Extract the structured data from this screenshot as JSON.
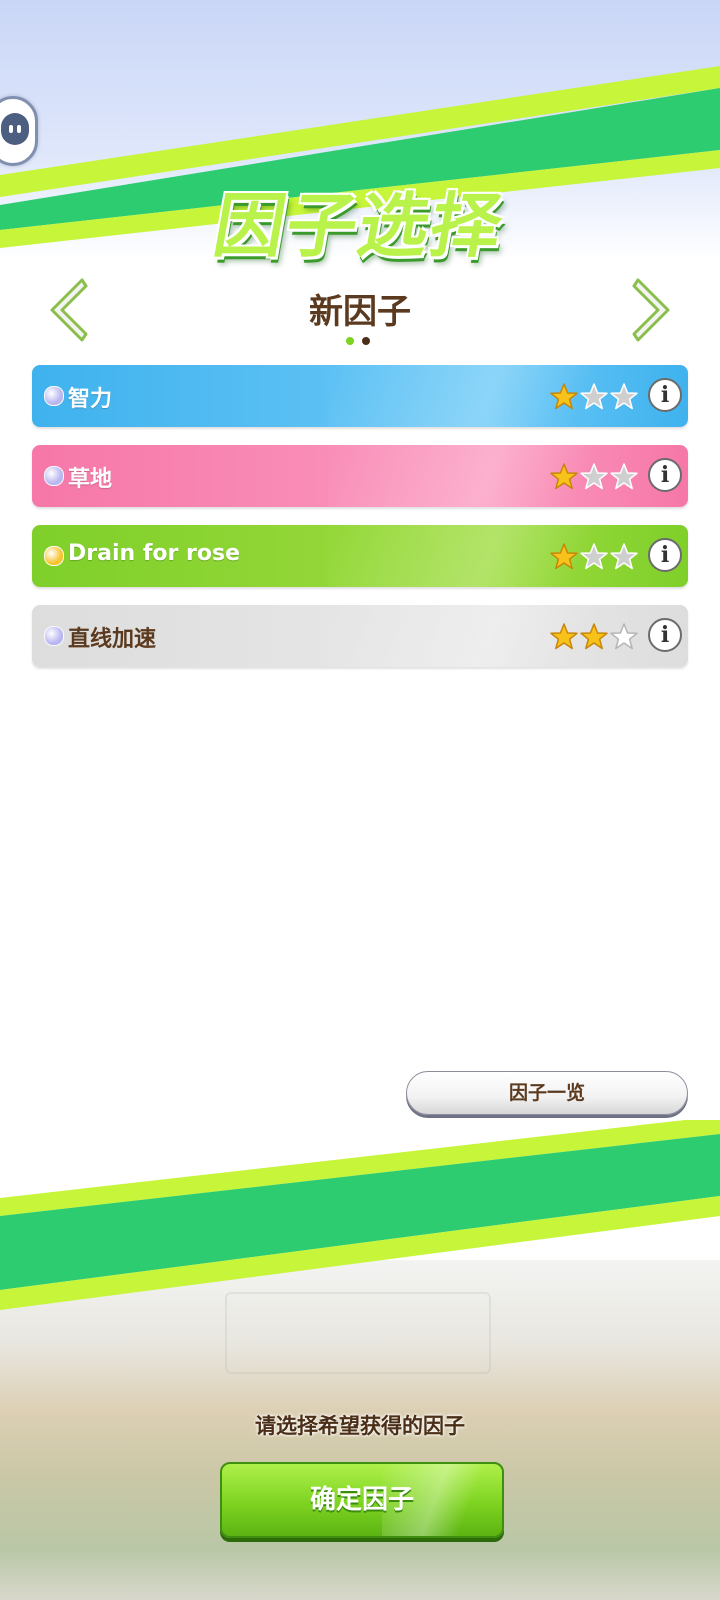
{
  "header": {
    "title": "因子选择"
  },
  "selector": {
    "subtitle": "新因子",
    "page_count": 2,
    "current_page": 1
  },
  "factors": [
    {
      "name": "智力",
      "rarity": 1,
      "max_rarity": 3,
      "bg": "#3fb2ee",
      "bg2": "#6cc9f7",
      "text_color": "#ffffff",
      "orb_color": "#b9b7f0"
    },
    {
      "name": "草地",
      "rarity": 1,
      "max_rarity": 3,
      "bg": "#f677a8",
      "bg2": "#fb9ac0",
      "text_color": "#ffffff",
      "orb_color": "#b9b7f0"
    },
    {
      "name": "Drain for rose",
      "rarity": 1,
      "max_rarity": 3,
      "bg": "#7fcf2a",
      "bg2": "#9edc3f",
      "text_color": "#ffffff",
      "orb_color": "#f5c531"
    },
    {
      "name": "直线加速",
      "rarity": 2,
      "max_rarity": 3,
      "bg": "#dddddd",
      "bg2": "#e9e9e9",
      "text_color": "#5b3a1f",
      "orb_color": "#b9b7f0"
    }
  ],
  "buttons": {
    "factor_list": "因子一览",
    "confirm": "确定因子"
  },
  "hint": "请选择希望获得的因子",
  "colors": {
    "accent_green": "#7ed321",
    "stripe_green": "#2ecc71",
    "stripe_lime": "#c6f53a",
    "brown_text": "#5b3a1f"
  }
}
